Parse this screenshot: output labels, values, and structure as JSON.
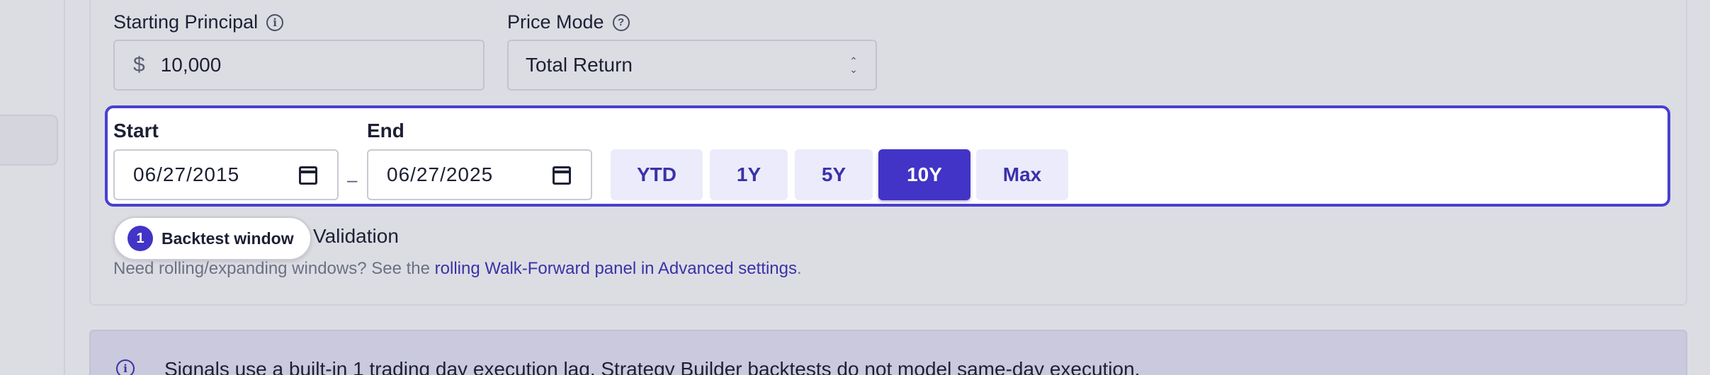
{
  "principal": {
    "label": "Starting Principal",
    "info_icon": "info-icon",
    "currency_symbol": "$",
    "value": "10,000"
  },
  "price_mode": {
    "label": "Price Mode",
    "help_icon": "help-icon",
    "selected": "Total Return"
  },
  "date_window": {
    "start_label": "Start",
    "start_value": "06/27/2015",
    "separator": "–",
    "end_label": "End",
    "end_value": "06/27/2025",
    "presets": [
      {
        "label": "YTD",
        "active": false
      },
      {
        "label": "1Y",
        "active": false
      },
      {
        "label": "5Y",
        "active": false
      },
      {
        "label": "10Y",
        "active": true
      },
      {
        "label": "Max",
        "active": false
      }
    ],
    "accent_color": "#4a3fd0"
  },
  "validation": {
    "step_number": "1",
    "step_label": "Backtest window",
    "text": "Validation",
    "hint_prefix": "Need rolling/expanding windows? See the ",
    "hint_link": "rolling Walk-Forward panel in Advanced settings",
    "hint_suffix": "."
  },
  "banner": {
    "icon": "info-icon",
    "text": "Signals use a built-in 1 trading day execution lag. Strategy Builder backtests do not model same-day execution."
  }
}
